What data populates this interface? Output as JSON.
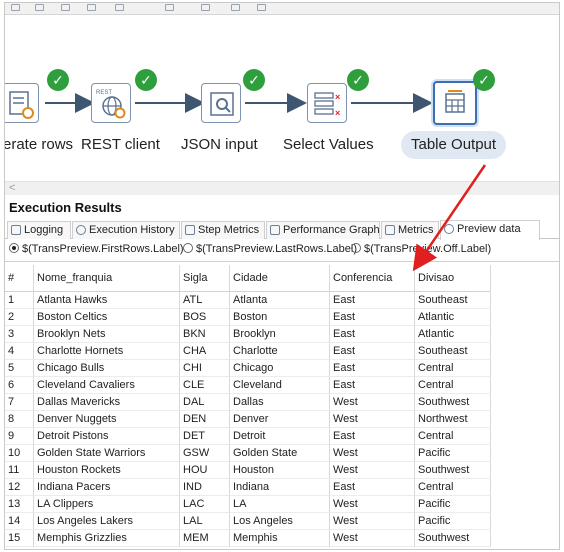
{
  "steps": [
    {
      "label": "erate rows",
      "icon": "generate-rows-icon",
      "status": "success"
    },
    {
      "label": "REST client",
      "icon": "rest-client-icon",
      "status": "success",
      "badge": "REST"
    },
    {
      "label": "JSON input",
      "icon": "json-input-icon",
      "status": "success"
    },
    {
      "label": "Select Values",
      "icon": "select-values-icon",
      "status": "success"
    },
    {
      "label": "Table Output",
      "icon": "table-output-icon",
      "status": "success",
      "selected": true
    }
  ],
  "scrollbar": {
    "left_arrow": "<"
  },
  "results": {
    "title": "Execution Results",
    "tabs": [
      {
        "label": "Logging",
        "icon": "logging-icon"
      },
      {
        "label": "Execution History",
        "icon": "history-icon"
      },
      {
        "label": "Step Metrics",
        "icon": "step-metrics-icon"
      },
      {
        "label": "Performance Graph",
        "icon": "performance-graph-icon"
      },
      {
        "label": "Metrics",
        "icon": "metrics-icon"
      },
      {
        "label": "Preview data",
        "icon": "preview-eye-icon",
        "active": true
      }
    ],
    "radios": [
      {
        "label": "$(TransPreview.FirstRows.Label)",
        "checked": true
      },
      {
        "label": "$(TransPreview.LastRows.Label)",
        "checked": false
      },
      {
        "label": "$(TransPreview.Off.Label)",
        "checked": false
      }
    ],
    "columns": [
      "#",
      "Nome_franquia",
      "Sigla",
      "Cidade",
      "Conferencia",
      "Divisao"
    ],
    "rows": [
      [
        "1",
        "Atlanta Hawks",
        "ATL",
        "Atlanta",
        "East",
        "Southeast"
      ],
      [
        "2",
        "Boston Celtics",
        "BOS",
        "Boston",
        "East",
        "Atlantic"
      ],
      [
        "3",
        "Brooklyn Nets",
        "BKN",
        "Brooklyn",
        "East",
        "Atlantic"
      ],
      [
        "4",
        "Charlotte Hornets",
        "CHA",
        "Charlotte",
        "East",
        "Southeast"
      ],
      [
        "5",
        "Chicago Bulls",
        "CHI",
        "Chicago",
        "East",
        "Central"
      ],
      [
        "6",
        "Cleveland Cavaliers",
        "CLE",
        "Cleveland",
        "East",
        "Central"
      ],
      [
        "7",
        "Dallas Mavericks",
        "DAL",
        "Dallas",
        "West",
        "Southwest"
      ],
      [
        "8",
        "Denver Nuggets",
        "DEN",
        "Denver",
        "West",
        "Northwest"
      ],
      [
        "9",
        "Detroit Pistons",
        "DET",
        "Detroit",
        "East",
        "Central"
      ],
      [
        "10",
        "Golden State Warriors",
        "GSW",
        "Golden State",
        "West",
        "Pacific"
      ],
      [
        "11",
        "Houston Rockets",
        "HOU",
        "Houston",
        "West",
        "Southwest"
      ],
      [
        "12",
        "Indiana Pacers",
        "IND",
        "Indiana",
        "East",
        "Central"
      ],
      [
        "13",
        "LA Clippers",
        "LAC",
        "LA",
        "West",
        "Pacific"
      ],
      [
        "14",
        "Los Angeles Lakers",
        "LAL",
        "Los Angeles",
        "West",
        "Pacific"
      ],
      [
        "15",
        "Memphis Grizzlies",
        "MEM",
        "Memphis",
        "West",
        "Southwest"
      ]
    ]
  },
  "colors": {
    "success": "#2f9f3e",
    "hop": "#3e5670",
    "annotation_arrow": "#e02020",
    "selected_label_bg": "#dfe8f3"
  }
}
